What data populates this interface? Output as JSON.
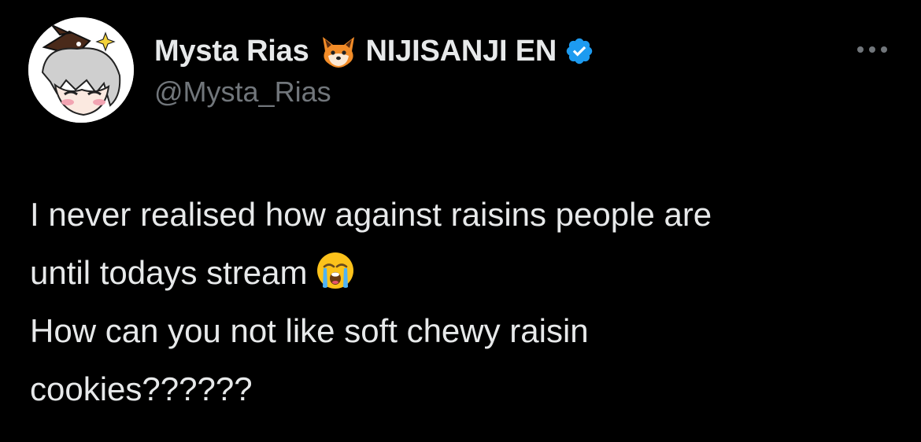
{
  "author": {
    "display_name": "Mysta Rias",
    "display_name_suffix": "NIJISANJI EN",
    "handle": "@Mysta_Rias",
    "name_emoji": "fox-icon",
    "verified_color": "#1d9bf0"
  },
  "tweet": {
    "lines": [
      "I never realised how against raisins people are",
      "until todays stream",
      "How can you not like soft chewy raisin",
      "cookies??????"
    ],
    "inline_emoji": "loudly-crying-face-icon"
  },
  "colors": {
    "background": "#000000",
    "text_primary": "#e7e9ea",
    "text_secondary": "#71767b"
  }
}
